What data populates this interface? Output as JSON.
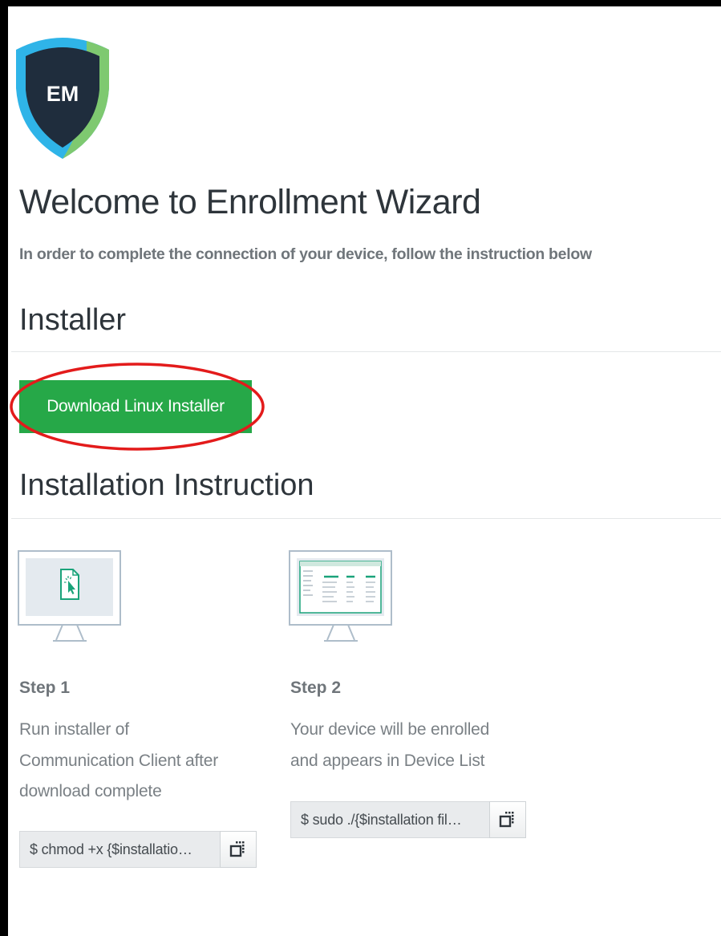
{
  "logo": {
    "text": "EM"
  },
  "header": {
    "title": "Welcome to Enrollment Wizard",
    "subtitle": "In order to complete the connection of your device, follow the instruction below"
  },
  "installer": {
    "section_title": "Installer",
    "download_button": "Download Linux Installer"
  },
  "instruction": {
    "section_title": "Installation Instruction",
    "steps": [
      {
        "title": "Step 1",
        "description_lines": [
          "Run installer of",
          "Communication Client after",
          "download complete"
        ],
        "command": "$ chmod +x {$installatio…",
        "icon": "file-download-monitor-icon"
      },
      {
        "title": "Step 2",
        "description_lines": [
          "Your device will be enrolled",
          "and appears in Device List"
        ],
        "command": "$ sudo ./{$installation fil…",
        "icon": "device-list-monitor-icon"
      }
    ]
  },
  "colors": {
    "accent_green": "#26a848",
    "highlight_red": "#e31b1b",
    "logo_dark": "#1f2d3d",
    "logo_blue": "#29a8e0"
  }
}
